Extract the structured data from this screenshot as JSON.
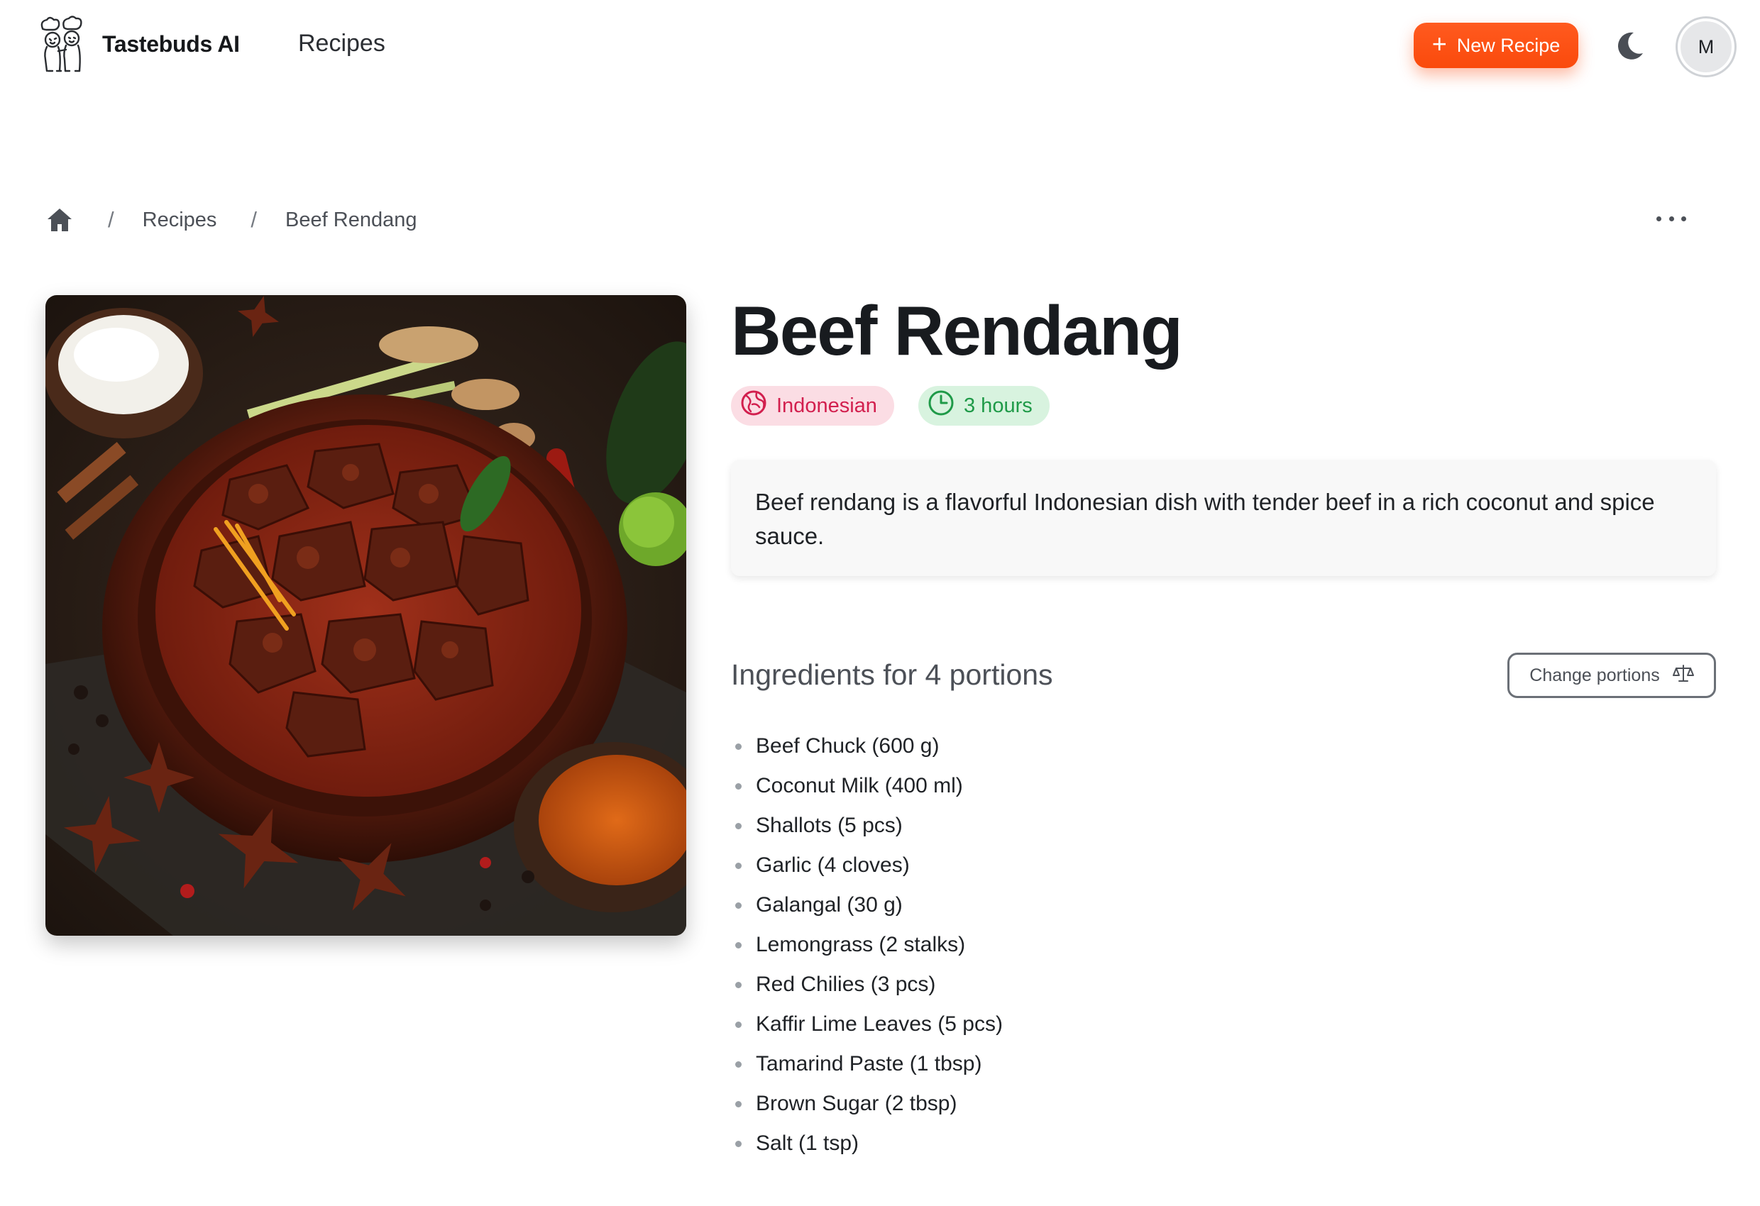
{
  "header": {
    "brand": "Tastebuds AI",
    "nav_recipes": "Recipes",
    "new_recipe_label": "New Recipe",
    "avatar_initial": "M",
    "accent_color": "#fa4a0c"
  },
  "breadcrumb": {
    "items": [
      "Recipes",
      "Beef Rendang"
    ]
  },
  "recipe": {
    "title": "Beef Rendang",
    "cuisine": "Indonesian",
    "duration": "3 hours",
    "description": "Beef rendang is a flavorful Indonesian dish with tender beef in a rich coconut and spice sauce.",
    "ingredients_title": "Ingredients for 4 portions",
    "change_portions_label": "Change portions",
    "ingredients": [
      "Beef Chuck (600 g)",
      "Coconut Milk (400 ml)",
      "Shallots (5 pcs)",
      "Garlic (4 cloves)",
      "Galangal (30 g)",
      "Lemongrass (2 stalks)",
      "Red Chilies (3 pcs)",
      "Kaffir Lime Leaves (5 pcs)",
      "Tamarind Paste (1 tbsp)",
      "Brown Sugar (2 tbsp)",
      "Salt (1 tsp)"
    ]
  },
  "icons": {
    "logo": "chef-duo-logo",
    "theme_toggle": "moon-icon",
    "home": "home-icon",
    "more": "more-horizontal-icon",
    "cuisine": "globe-icon",
    "time": "clock-icon",
    "portions": "scale-icon",
    "new_recipe": "plus-icon"
  },
  "colors": {
    "cuisine_badge_bg": "#fbdde4",
    "cuisine_badge_text": "#d21f4e",
    "time_badge_bg": "#d8f3df",
    "time_badge_text": "#1f9a48"
  }
}
